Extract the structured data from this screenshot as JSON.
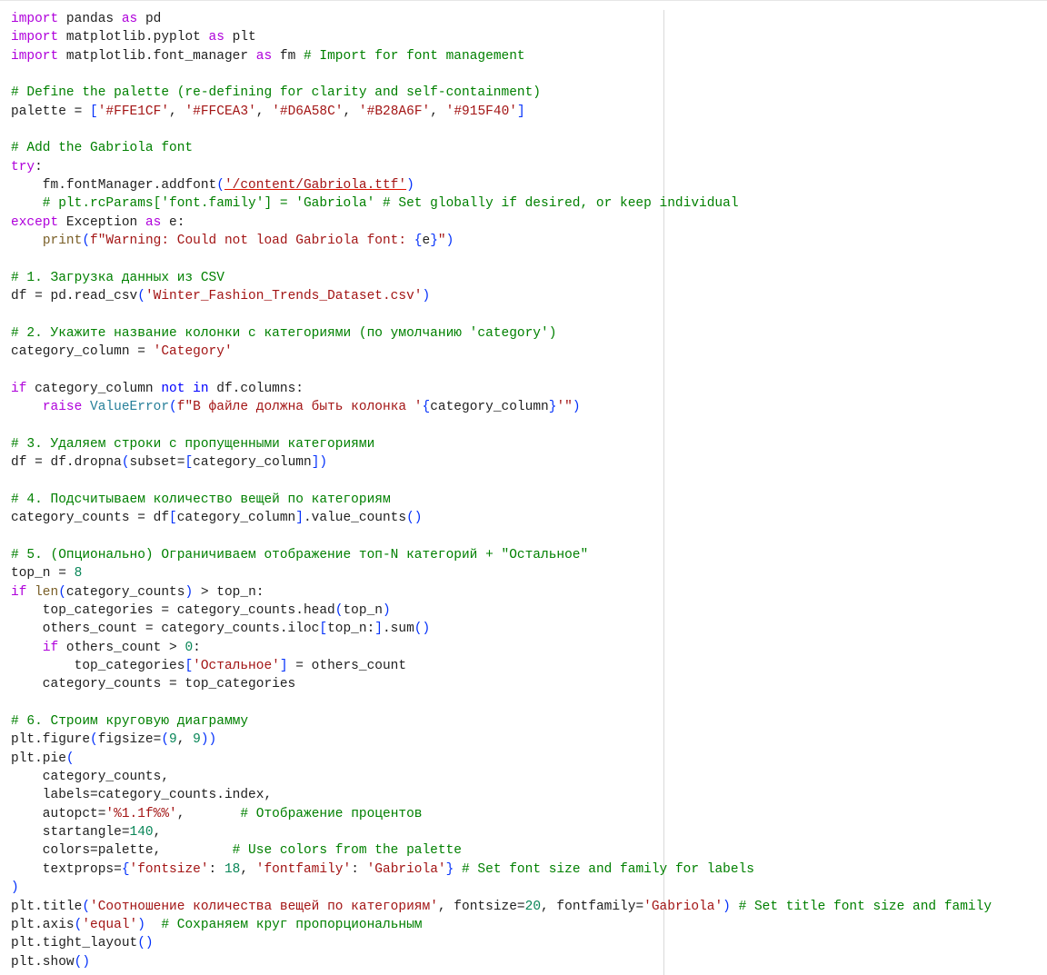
{
  "editor": {
    "lines": [
      [
        {
          "t": "import",
          "c": "kw"
        },
        {
          "t": " pandas ",
          "c": "tx"
        },
        {
          "t": "as",
          "c": "kw"
        },
        {
          "t": " pd",
          "c": "tx"
        }
      ],
      [
        {
          "t": "import",
          "c": "kw"
        },
        {
          "t": " matplotlib.pyplot ",
          "c": "tx"
        },
        {
          "t": "as",
          "c": "kw"
        },
        {
          "t": " plt",
          "c": "tx"
        }
      ],
      [
        {
          "t": "import",
          "c": "kw"
        },
        {
          "t": " matplotlib.font_manager ",
          "c": "tx"
        },
        {
          "t": "as",
          "c": "kw"
        },
        {
          "t": " fm ",
          "c": "tx"
        },
        {
          "t": "# Import for font management",
          "c": "com"
        }
      ],
      [],
      [
        {
          "t": "# Define the palette (re-defining for clarity and self-containment)",
          "c": "com"
        }
      ],
      [
        {
          "t": "palette = ",
          "c": "tx"
        },
        {
          "t": "[",
          "c": "br"
        },
        {
          "t": "'#FFE1CF'",
          "c": "str"
        },
        {
          "t": ", ",
          "c": "tx"
        },
        {
          "t": "'#FFCEA3'",
          "c": "str"
        },
        {
          "t": ", ",
          "c": "tx"
        },
        {
          "t": "'#D6A58C'",
          "c": "str"
        },
        {
          "t": ", ",
          "c": "tx"
        },
        {
          "t": "'#B28A6F'",
          "c": "str"
        },
        {
          "t": ", ",
          "c": "tx"
        },
        {
          "t": "'#915F40'",
          "c": "str"
        },
        {
          "t": "]",
          "c": "br"
        }
      ],
      [],
      [
        {
          "t": "# Add the Gabriola font",
          "c": "com"
        }
      ],
      [
        {
          "t": "try",
          "c": "kw"
        },
        {
          "t": ":",
          "c": "tx"
        }
      ],
      [
        {
          "t": "    fm.fontManager.addfont",
          "c": "tx"
        },
        {
          "t": "(",
          "c": "br"
        },
        {
          "t": "'/content/Gabriola.ttf'",
          "c": "squiggle"
        },
        {
          "t": ")",
          "c": "br"
        }
      ],
      [
        {
          "t": "    # plt.rcParams['font.family'] = 'Gabriola' # Set globally if desired, or keep individual",
          "c": "com"
        }
      ],
      [
        {
          "t": "except",
          "c": "kw"
        },
        {
          "t": " Exception ",
          "c": "tx"
        },
        {
          "t": "as",
          "c": "kw"
        },
        {
          "t": " e:",
          "c": "tx"
        }
      ],
      [
        {
          "t": "    ",
          "c": "tx"
        },
        {
          "t": "print",
          "c": "fn"
        },
        {
          "t": "(",
          "c": "br"
        },
        {
          "t": "f\"Warning: Could not load Gabriola font: ",
          "c": "str"
        },
        {
          "t": "{",
          "c": "br"
        },
        {
          "t": "e",
          "c": "tx"
        },
        {
          "t": "}",
          "c": "br"
        },
        {
          "t": "\"",
          "c": "str"
        },
        {
          "t": ")",
          "c": "br"
        }
      ],
      [],
      [
        {
          "t": "# 1. Загрузка данных из CSV",
          "c": "com"
        }
      ],
      [
        {
          "t": "df = pd.read_csv",
          "c": "tx"
        },
        {
          "t": "(",
          "c": "br"
        },
        {
          "t": "'Winter_Fashion_Trends_Dataset.csv'",
          "c": "str"
        },
        {
          "t": ")",
          "c": "br"
        }
      ],
      [],
      [
        {
          "t": "# 2. Укажите название колонки с категориями (по умолчанию 'category')",
          "c": "com"
        }
      ],
      [
        {
          "t": "category_column = ",
          "c": "tx"
        },
        {
          "t": "'Category'",
          "c": "str"
        }
      ],
      [],
      [
        {
          "t": "if",
          "c": "kw"
        },
        {
          "t": " category_column ",
          "c": "tx"
        },
        {
          "t": "not",
          "c": "kw2"
        },
        {
          "t": " ",
          "c": "tx"
        },
        {
          "t": "in",
          "c": "kw2"
        },
        {
          "t": " df.columns:",
          "c": "tx"
        }
      ],
      [
        {
          "t": "    ",
          "c": "tx"
        },
        {
          "t": "raise",
          "c": "kw"
        },
        {
          "t": " ",
          "c": "tx"
        },
        {
          "t": "ValueError",
          "c": "cls"
        },
        {
          "t": "(",
          "c": "br"
        },
        {
          "t": "f\"В файле должна быть колонка '",
          "c": "str"
        },
        {
          "t": "{",
          "c": "br"
        },
        {
          "t": "category_column",
          "c": "tx"
        },
        {
          "t": "}",
          "c": "br"
        },
        {
          "t": "'\"",
          "c": "str"
        },
        {
          "t": ")",
          "c": "br"
        }
      ],
      [],
      [
        {
          "t": "# 3. Удаляем строки с пропущенными категориями",
          "c": "com"
        }
      ],
      [
        {
          "t": "df = df.dropna",
          "c": "tx"
        },
        {
          "t": "(",
          "c": "br"
        },
        {
          "t": "subset=",
          "c": "tx"
        },
        {
          "t": "[",
          "c": "br"
        },
        {
          "t": "category_column",
          "c": "tx"
        },
        {
          "t": "])",
          "c": "br"
        }
      ],
      [],
      [
        {
          "t": "# 4. Подсчитываем количество вещей по категориям",
          "c": "com"
        }
      ],
      [
        {
          "t": "category_counts = df",
          "c": "tx"
        },
        {
          "t": "[",
          "c": "br"
        },
        {
          "t": "category_column",
          "c": "tx"
        },
        {
          "t": "]",
          "c": "br"
        },
        {
          "t": ".value_counts",
          "c": "tx"
        },
        {
          "t": "()",
          "c": "br"
        }
      ],
      [],
      [
        {
          "t": "# 5. (Опционально) Ограничиваем отображение топ-N категорий + \"Остальное\"",
          "c": "com"
        }
      ],
      [
        {
          "t": "top_n = ",
          "c": "tx"
        },
        {
          "t": "8",
          "c": "num"
        }
      ],
      [
        {
          "t": "if",
          "c": "kw"
        },
        {
          "t": " ",
          "c": "tx"
        },
        {
          "t": "len",
          "c": "fn"
        },
        {
          "t": "(",
          "c": "br"
        },
        {
          "t": "category_counts",
          "c": "tx"
        },
        {
          "t": ")",
          "c": "br"
        },
        {
          "t": " > top_n:",
          "c": "tx"
        }
      ],
      [
        {
          "t": "    top_categories = category_counts.head",
          "c": "tx"
        },
        {
          "t": "(",
          "c": "br"
        },
        {
          "t": "top_n",
          "c": "tx"
        },
        {
          "t": ")",
          "c": "br"
        }
      ],
      [
        {
          "t": "    others_count = category_counts.iloc",
          "c": "tx"
        },
        {
          "t": "[",
          "c": "br"
        },
        {
          "t": "top_n:",
          "c": "tx"
        },
        {
          "t": "]",
          "c": "br"
        },
        {
          "t": ".sum",
          "c": "tx"
        },
        {
          "t": "()",
          "c": "br"
        }
      ],
      [
        {
          "t": "    ",
          "c": "tx"
        },
        {
          "t": "if",
          "c": "kw"
        },
        {
          "t": " others_count > ",
          "c": "tx"
        },
        {
          "t": "0",
          "c": "num"
        },
        {
          "t": ":",
          "c": "tx"
        }
      ],
      [
        {
          "t": "        top_categories",
          "c": "tx"
        },
        {
          "t": "[",
          "c": "br"
        },
        {
          "t": "'Остальное'",
          "c": "str"
        },
        {
          "t": "]",
          "c": "br"
        },
        {
          "t": " = others_count",
          "c": "tx"
        }
      ],
      [
        {
          "t": "    category_counts = top_categories",
          "c": "tx"
        }
      ],
      [],
      [
        {
          "t": "# 6. Строим круговую диаграмму",
          "c": "com"
        }
      ],
      [
        {
          "t": "plt.figure",
          "c": "tx"
        },
        {
          "t": "(",
          "c": "br"
        },
        {
          "t": "figsize=",
          "c": "tx"
        },
        {
          "t": "(",
          "c": "br"
        },
        {
          "t": "9",
          "c": "num"
        },
        {
          "t": ", ",
          "c": "tx"
        },
        {
          "t": "9",
          "c": "num"
        },
        {
          "t": "))",
          "c": "br"
        }
      ],
      [
        {
          "t": "plt.pie",
          "c": "tx"
        },
        {
          "t": "(",
          "c": "br"
        }
      ],
      [
        {
          "t": "    category_counts,",
          "c": "tx"
        }
      ],
      [
        {
          "t": "    labels=category_counts.index,",
          "c": "tx"
        }
      ],
      [
        {
          "t": "    autopct=",
          "c": "tx"
        },
        {
          "t": "'%1.1f%%'",
          "c": "str"
        },
        {
          "t": ",       ",
          "c": "tx"
        },
        {
          "t": "# Отображение процентов",
          "c": "com"
        }
      ],
      [
        {
          "t": "    startangle=",
          "c": "tx"
        },
        {
          "t": "140",
          "c": "num"
        },
        {
          "t": ",",
          "c": "tx"
        }
      ],
      [
        {
          "t": "    colors=palette,         ",
          "c": "tx"
        },
        {
          "t": "# Use colors from the palette",
          "c": "com"
        }
      ],
      [
        {
          "t": "    textprops=",
          "c": "tx"
        },
        {
          "t": "{",
          "c": "br"
        },
        {
          "t": "'fontsize'",
          "c": "str"
        },
        {
          "t": ": ",
          "c": "tx"
        },
        {
          "t": "18",
          "c": "num"
        },
        {
          "t": ", ",
          "c": "tx"
        },
        {
          "t": "'fontfamily'",
          "c": "str"
        },
        {
          "t": ": ",
          "c": "tx"
        },
        {
          "t": "'Gabriola'",
          "c": "str"
        },
        {
          "t": "}",
          "c": "br"
        },
        {
          "t": " ",
          "c": "tx"
        },
        {
          "t": "# Set font size and family for labels",
          "c": "com"
        }
      ],
      [
        {
          "t": ")",
          "c": "br"
        }
      ],
      [
        {
          "t": "plt.title",
          "c": "tx"
        },
        {
          "t": "(",
          "c": "br"
        },
        {
          "t": "'Соотношение количества вещей по категориям'",
          "c": "str"
        },
        {
          "t": ", fontsize=",
          "c": "tx"
        },
        {
          "t": "20",
          "c": "num"
        },
        {
          "t": ", fontfamily=",
          "c": "tx"
        },
        {
          "t": "'Gabriola'",
          "c": "str"
        },
        {
          "t": ")",
          "c": "br"
        },
        {
          "t": " ",
          "c": "tx"
        },
        {
          "t": "# Set title font size and family",
          "c": "com"
        }
      ],
      [
        {
          "t": "plt.axis",
          "c": "tx"
        },
        {
          "t": "(",
          "c": "br"
        },
        {
          "t": "'equal'",
          "c": "str"
        },
        {
          "t": ")",
          "c": "br"
        },
        {
          "t": "  ",
          "c": "tx"
        },
        {
          "t": "# Сохраняем круг пропорциональным",
          "c": "com"
        }
      ],
      [
        {
          "t": "plt.tight_layout",
          "c": "tx"
        },
        {
          "t": "()",
          "c": "br"
        }
      ],
      [
        {
          "t": "plt.show",
          "c": "tx"
        },
        {
          "t": "()",
          "c": "br"
        }
      ]
    ]
  }
}
